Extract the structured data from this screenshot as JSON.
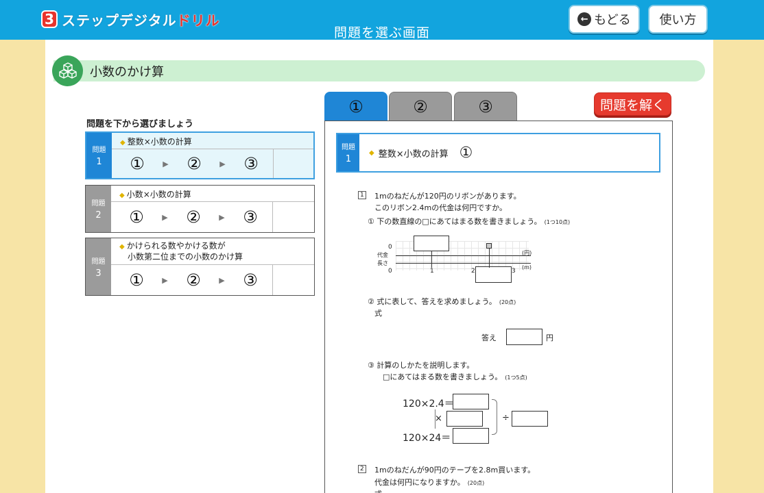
{
  "header": {
    "logo_number": "3",
    "logo_text_a": "ステップ",
    "logo_text_b": "デジタル",
    "logo_text_c": "ドリル",
    "title": "問題を選ぶ画面",
    "back_icon": "arrow-left-circle-icon",
    "back_label": "もどる",
    "help_label": "使い方"
  },
  "section": {
    "icon": "cubes-icon",
    "title": "小数のかけ算"
  },
  "list": {
    "instruction": "問題を下から選びましょう",
    "problems": [
      {
        "tab_label": "問題",
        "number": "1",
        "title": "整数×小数の計算",
        "title2": "",
        "steps": [
          "①",
          "②",
          "③"
        ]
      },
      {
        "tab_label": "問題",
        "number": "2",
        "title": "小数×小数の計算",
        "title2": "",
        "steps": [
          "①",
          "②",
          "③"
        ]
      },
      {
        "tab_label": "問題",
        "number": "3",
        "title": "かけられる数やかける数が",
        "title2": "小数第二位までの小数のかけ算",
        "steps": [
          "①",
          "②",
          "③"
        ]
      }
    ]
  },
  "tabs": [
    "①",
    "②",
    "③"
  ],
  "solve_label": "問題を解く",
  "preview": {
    "tab_label": "問題",
    "number": "1",
    "title": "整数×小数の計算",
    "part": "①",
    "q1_num": "1",
    "q1_line1": "1mのねだんが120円のリボンがあります。",
    "q1_line2": "このリボン2.4mの代金は何円ですか。",
    "sub1": "①  下の数直線の□にあてはまる数を書きましょう。",
    "sub1_points": "(1つ10点)",
    "nl_zero_top": "0",
    "nl_price": "代金",
    "nl_length": "長さ",
    "nl_yen": "(円)",
    "nl_m": "(m)",
    "nl_ticks": [
      "0",
      "1",
      "2",
      "3"
    ],
    "sub2": "②  式に表して、答えを求めましょう。",
    "sub2_points": "(20点)",
    "shiki": "式",
    "answer_label": "答え",
    "answer_unit": "円",
    "sub3": "③  計算のしかたを説明します。",
    "sub3_line2": "□にあてはまる数を書きましょう。",
    "sub3_points": "(1つ5点)",
    "calc_top": "120×2.4＝",
    "calc_mid": "×",
    "calc_bottom": "120×24＝",
    "calc_div": "÷",
    "q2_num": "2",
    "q2_line1": "1mのねだんが90円のテープを2.8m買います。",
    "q2_line2": "代金は何円になりますか。",
    "q2_points": "(20点)",
    "q2_shiki": "式"
  }
}
